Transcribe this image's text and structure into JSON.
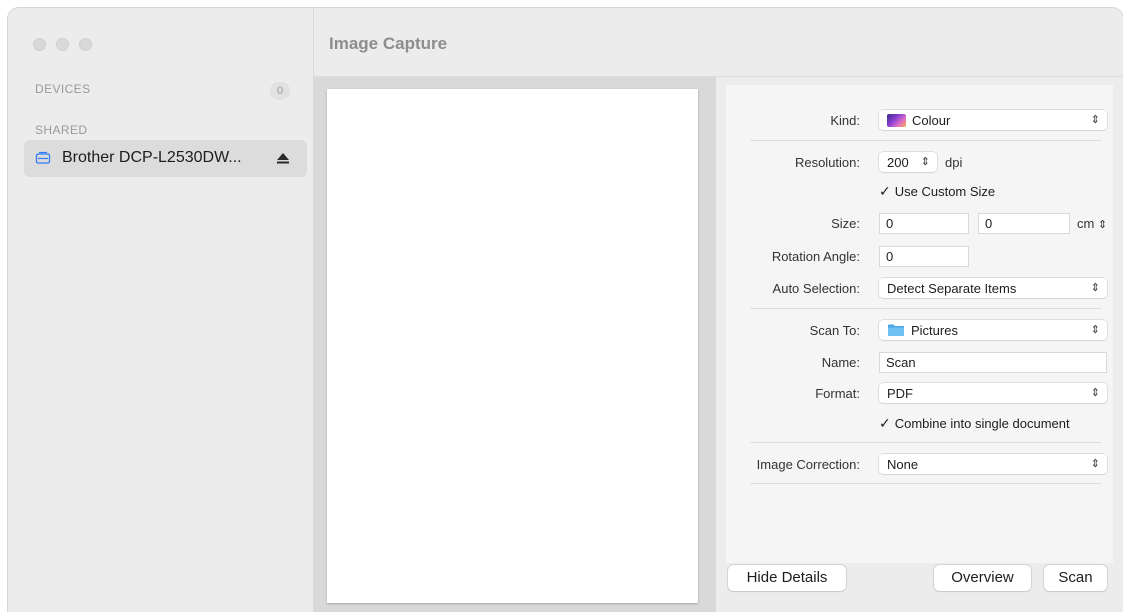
{
  "app": {
    "title": "Image Capture"
  },
  "sidebar": {
    "devices_label": "DEVICES",
    "devices_count": "0",
    "shared_label": "SHARED",
    "shared_items": [
      {
        "label": "Brother DCP-L2530DW...",
        "icon": "scanner-icon"
      }
    ]
  },
  "settings": {
    "kind": {
      "label": "Kind:",
      "value": "Colour",
      "icon": "colour-swatch-icon"
    },
    "resolution": {
      "label": "Resolution:",
      "value": "200",
      "unit": "dpi"
    },
    "use_custom_size": {
      "label": "Use Custom Size",
      "checked": true
    },
    "size": {
      "label": "Size:",
      "width": "0",
      "height": "0",
      "unit": "cm"
    },
    "rotation": {
      "label": "Rotation Angle:",
      "value": "0"
    },
    "auto_selection": {
      "label": "Auto Selection:",
      "value": "Detect Separate Items"
    },
    "scan_to": {
      "label": "Scan To:",
      "value": "Pictures",
      "icon": "folder-icon"
    },
    "name": {
      "label": "Name:",
      "value": "Scan"
    },
    "format": {
      "label": "Format:",
      "value": "PDF"
    },
    "combine": {
      "label": "Combine into single document",
      "checked": true
    },
    "image_correction": {
      "label": "Image Correction:",
      "value": "None"
    }
  },
  "buttons": {
    "hide_details": "Hide Details",
    "overview": "Overview",
    "scan": "Scan"
  },
  "glyphs": {
    "check": "✓",
    "updown": "⌃⌄",
    "eject": "⏏"
  },
  "colors": {
    "accent": "#2f7cf6",
    "sidebar_selected": "#dcdcdc",
    "folder": "#4aa8e8"
  }
}
